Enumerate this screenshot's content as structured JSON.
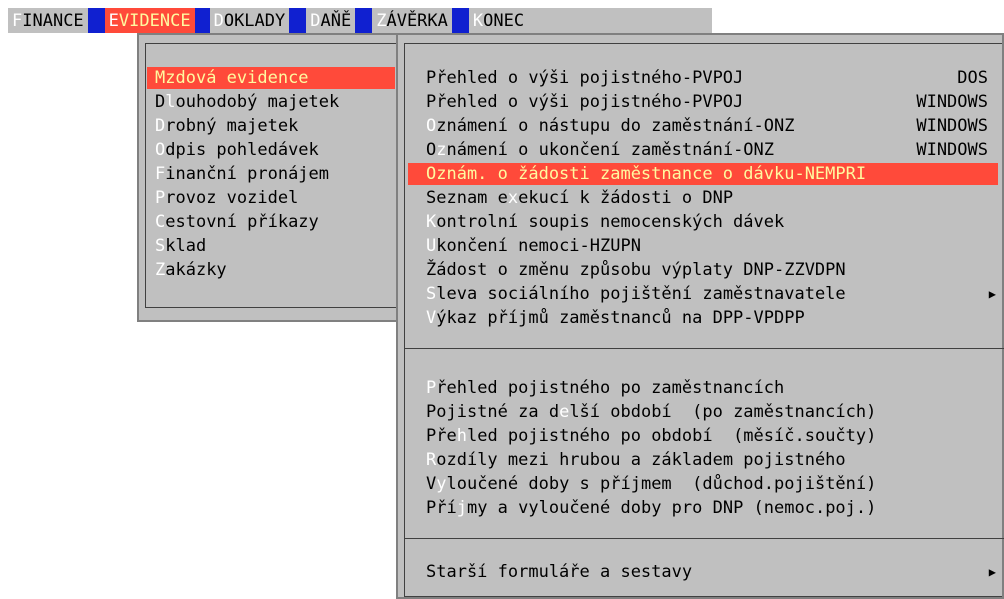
{
  "menubar": [
    {
      "hot": "F",
      "rest": "INANCE",
      "active": false
    },
    {
      "hot": "E",
      "rest": "VIDENCE",
      "active": true
    },
    {
      "hot": "D",
      "rest": "OKLADY",
      "active": false
    },
    {
      "hot": "D",
      "rest": "AŇĚ",
      "active": false
    },
    {
      "hot": "Z",
      "rest": "ÁVĚRKA",
      "active": false
    },
    {
      "hot": "K",
      "rest": "ONEC",
      "active": false
    }
  ],
  "evidence_menu": [
    {
      "pre": "",
      "hot": "M",
      "rest": "zdová evidence",
      "selected": true
    },
    {
      "pre": "D",
      "hot": "l",
      "rest": "ouhodobý majetek",
      "selected": false
    },
    {
      "pre": "",
      "hot": "D",
      "rest": "robný majetek",
      "selected": false
    },
    {
      "pre": "",
      "hot": "O",
      "rest": "dpis pohledávek",
      "selected": false
    },
    {
      "pre": "",
      "hot": "F",
      "rest": "inanční pronájem",
      "selected": false
    },
    {
      "pre": "",
      "hot": "P",
      "rest": "rovoz vozidel",
      "selected": false
    },
    {
      "pre": "",
      "hot": "C",
      "rest": "estovní příkazy",
      "selected": false
    },
    {
      "pre": "",
      "hot": "S",
      "rest": "klad",
      "selected": false
    },
    {
      "pre": "",
      "hot": "Z",
      "rest": "akázky",
      "selected": false
    }
  ],
  "mzdova_menu": {
    "group1": [
      {
        "pre": "",
        "hot": "",
        "rest": "Přehled o výši pojistného-PVPOJ",
        "right": "DOS",
        "selected": false,
        "submenu": false
      },
      {
        "pre": "",
        "hot": "",
        "rest": "Přehled o výši pojistného-PVPOJ",
        "right": "WINDOWS",
        "selected": false,
        "submenu": false
      },
      {
        "pre": "",
        "hot": "O",
        "rest": "známení o nástupu do zaměstnání-ONZ",
        "right": "WINDOWS",
        "selected": false,
        "submenu": false
      },
      {
        "pre": "O",
        "hot": "z",
        "rest": "námení o ukončení zaměstnání-ONZ",
        "right": "WINDOWS",
        "selected": false,
        "submenu": false
      },
      {
        "pre": "",
        "hot": "",
        "rest": "Oznám. o žádosti zaměstnance o dávku-NEMPRI",
        "right": "",
        "selected": true,
        "submenu": false
      },
      {
        "pre": "Seznam e",
        "hot": "x",
        "rest": "ekucí k žádosti o DNP",
        "right": "",
        "selected": false,
        "submenu": false
      },
      {
        "pre": "",
        "hot": "K",
        "rest": "ontrolní soupis nemocenských dávek",
        "right": "",
        "selected": false,
        "submenu": false
      },
      {
        "pre": "",
        "hot": "U",
        "rest": "končení nemoci-HZUPN",
        "right": "",
        "selected": false,
        "submenu": false
      },
      {
        "pre": "",
        "hot": "",
        "rest": "Žádost o změnu způsobu výplaty DNP-ZZVDPN",
        "right": "",
        "selected": false,
        "submenu": false
      },
      {
        "pre": "",
        "hot": "S",
        "rest": "leva sociálního pojištění zaměstnavatele",
        "right": "",
        "selected": false,
        "submenu": true
      },
      {
        "pre": "",
        "hot": "V",
        "rest": "ýkaz příjmů zaměstnanců na DPP-VPDPP",
        "right": "",
        "selected": false,
        "submenu": false
      }
    ],
    "group2": [
      {
        "pre": "",
        "hot": "P",
        "rest": "řehled pojistného po zaměstnancích",
        "right": "",
        "selected": false,
        "submenu": false
      },
      {
        "pre": "Pojistné za d",
        "hot": "e",
        "rest": "lší období  (po zaměstnancích)",
        "right": "",
        "selected": false,
        "submenu": false
      },
      {
        "pre": "Pře",
        "hot": "h",
        "rest": "led pojistného po období  (měsíč.součty)",
        "right": "",
        "selected": false,
        "submenu": false
      },
      {
        "pre": "",
        "hot": "R",
        "rest": "ozdíly mezi hrubou a základem pojistného",
        "right": "",
        "selected": false,
        "submenu": false
      },
      {
        "pre": "V",
        "hot": "y",
        "rest": "loučené doby s příjmem  (důchod.pojištění)",
        "right": "",
        "selected": false,
        "submenu": false
      },
      {
        "pre": "Pří",
        "hot": "j",
        "rest": "my a vyloučené doby pro DNP (nemoc.poj.)",
        "right": "",
        "selected": false,
        "submenu": false
      }
    ],
    "group3": [
      {
        "pre": "",
        "hot": "",
        "rest": "Starší formuláře a sestavy",
        "right": "",
        "selected": false,
        "submenu": true
      }
    ]
  },
  "icons": {
    "submenu_arrow": "right-triangle-icon"
  }
}
